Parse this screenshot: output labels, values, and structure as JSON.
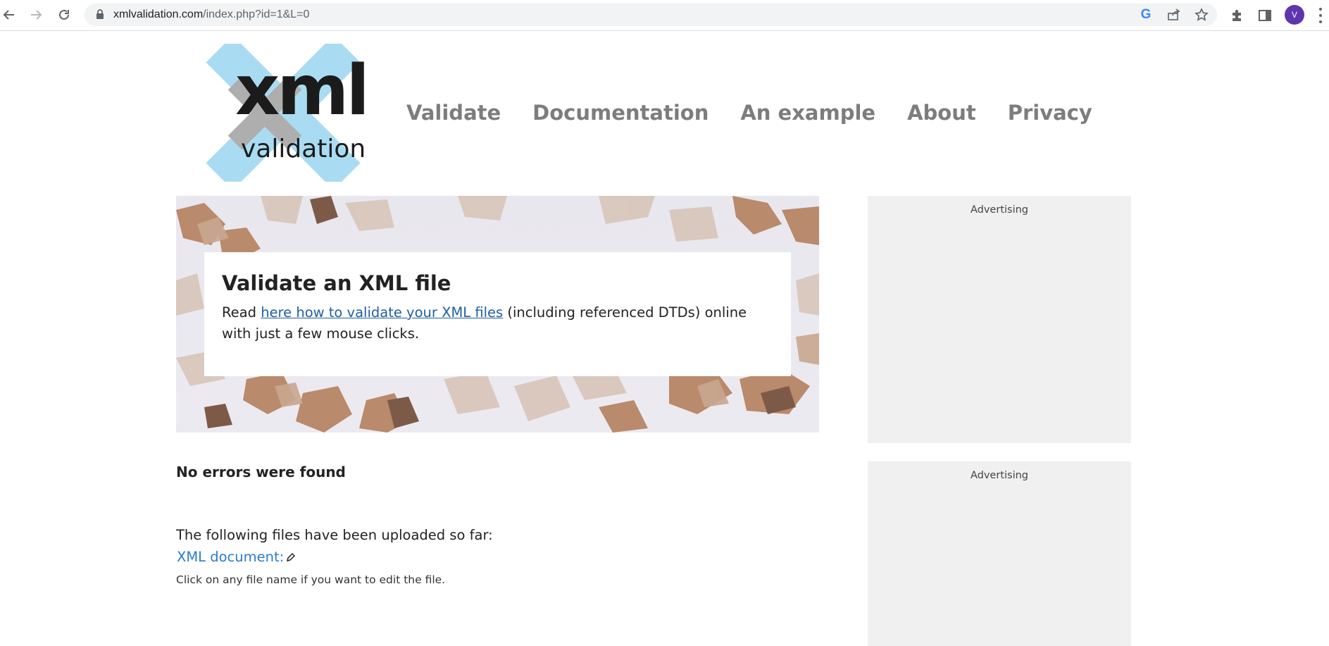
{
  "browser": {
    "url_host": "xmlvalidation.com",
    "url_path": "/index.php?id=1&L=0",
    "profile_initial": "V"
  },
  "site": {
    "logo_word": "xml",
    "logo_sub": "validation",
    "nav": [
      "Validate",
      "Documentation",
      "An example",
      "About",
      "Privacy"
    ]
  },
  "hero": {
    "title": "Validate an XML file",
    "text_before": "Read ",
    "link_text": "here how to validate your XML files",
    "text_after": " (including referenced DTDs) online with just a few mouse clicks."
  },
  "results": {
    "status": "No errors were found",
    "uploaded_label": "The following files have been uploaded so far:",
    "file_link": "XML document:",
    "hint": "Click on any file name if you want to edit the file."
  },
  "ads": {
    "label_1": "Advertising",
    "label_2": "Advertising"
  },
  "colors": {
    "logo_cross": "#a9dcf2",
    "logo_cross_inner": "#aeaeae",
    "nav_text": "#7d7d7d",
    "link": "#1f5fa3",
    "file_link": "#2a7bd0",
    "ad_bg": "#f0f0f0",
    "avatar": "#5e35b1"
  }
}
